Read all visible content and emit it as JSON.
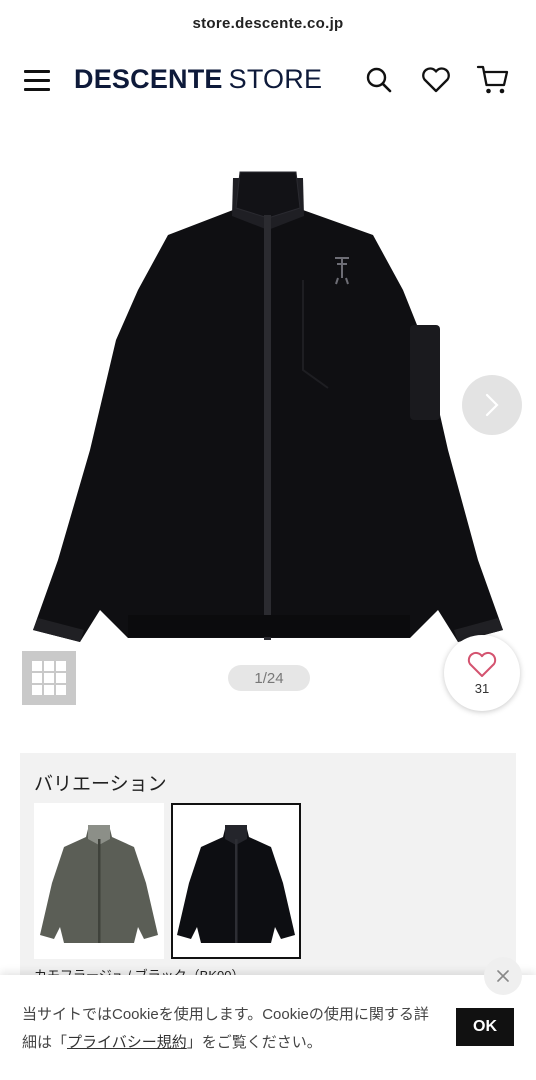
{
  "browser": {
    "url": "store.descente.co.jp"
  },
  "header": {
    "brand_main": "DESCENTE",
    "brand_sub": "STORE"
  },
  "icons": {
    "menu": "hamburger-icon",
    "search": "search-icon",
    "wishlist": "heart-icon",
    "cart": "cart-icon"
  },
  "gallery": {
    "pager": "1/24",
    "favorite_count": "31"
  },
  "variation": {
    "title": "バリエーション",
    "options": [
      {
        "color_hex": "#5b5e56",
        "selected": false
      },
      {
        "color_hex": "#0d0e12",
        "selected": true
      }
    ],
    "caption": "カモフラージュ / ブラック（BK00）"
  },
  "cookie": {
    "text_before": "当サイトではCookieを使用します。Cookieの使用に関する詳細は「",
    "link_text": "プライバシー規約",
    "text_after": "」をご覧ください。",
    "ok_label": "OK"
  },
  "colors": {
    "brand": "#0e1a3a",
    "ok_button": "#111111"
  }
}
